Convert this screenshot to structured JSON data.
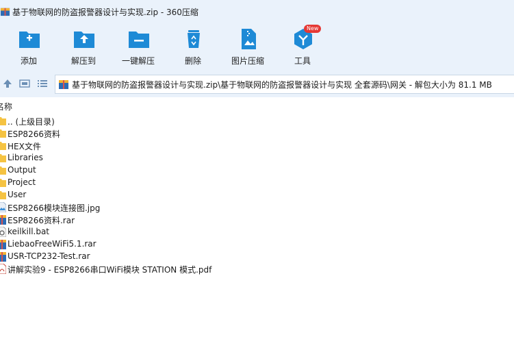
{
  "window": {
    "title": "基于物联网的防盗报警器设计与实现.zip - 360压缩"
  },
  "toolbar": {
    "items": [
      {
        "label": "添加",
        "icon": "add-folder-icon"
      },
      {
        "label": "解压到",
        "icon": "extract-to-icon"
      },
      {
        "label": "一键解压",
        "icon": "one-click-extract-icon"
      },
      {
        "label": "删除",
        "icon": "recycle-bin-icon"
      },
      {
        "label": "图片压缩",
        "icon": "image-compress-icon"
      },
      {
        "label": "工具",
        "icon": "tools-icon",
        "badge": "New"
      }
    ]
  },
  "address": {
    "path": "基于物联网的防盗报警器设计与实现.zip\\基于物联网的防盗报警器设计与实现 全套源码\\网关 - 解包大小为 81.1 MB"
  },
  "list": {
    "header": "名称",
    "rows": [
      {
        "name": ".. (上级目录)",
        "type": "folder-up"
      },
      {
        "name": "ESP8266资料",
        "type": "folder"
      },
      {
        "name": "HEX文件",
        "type": "folder"
      },
      {
        "name": "Libraries",
        "type": "folder"
      },
      {
        "name": "Output",
        "type": "folder"
      },
      {
        "name": "Project",
        "type": "folder"
      },
      {
        "name": "User",
        "type": "folder"
      },
      {
        "name": "ESP8266模块连接图.jpg",
        "type": "image"
      },
      {
        "name": "ESP8266资料.rar",
        "type": "archive"
      },
      {
        "name": "keilkill.bat",
        "type": "batch"
      },
      {
        "name": "LiebaoFreeWiFi5.1.rar",
        "type": "archive"
      },
      {
        "name": "USR-TCP232-Test.rar",
        "type": "archive"
      },
      {
        "name": "讲解实验9 - ESP8266串口WiFi模块 STATION 模式.pdf",
        "type": "pdf"
      }
    ]
  },
  "colors": {
    "chrome_bg": "#eaf2fb",
    "accent": "#1e8ad6",
    "folder": "#f5c342",
    "badge": "#e53935"
  }
}
